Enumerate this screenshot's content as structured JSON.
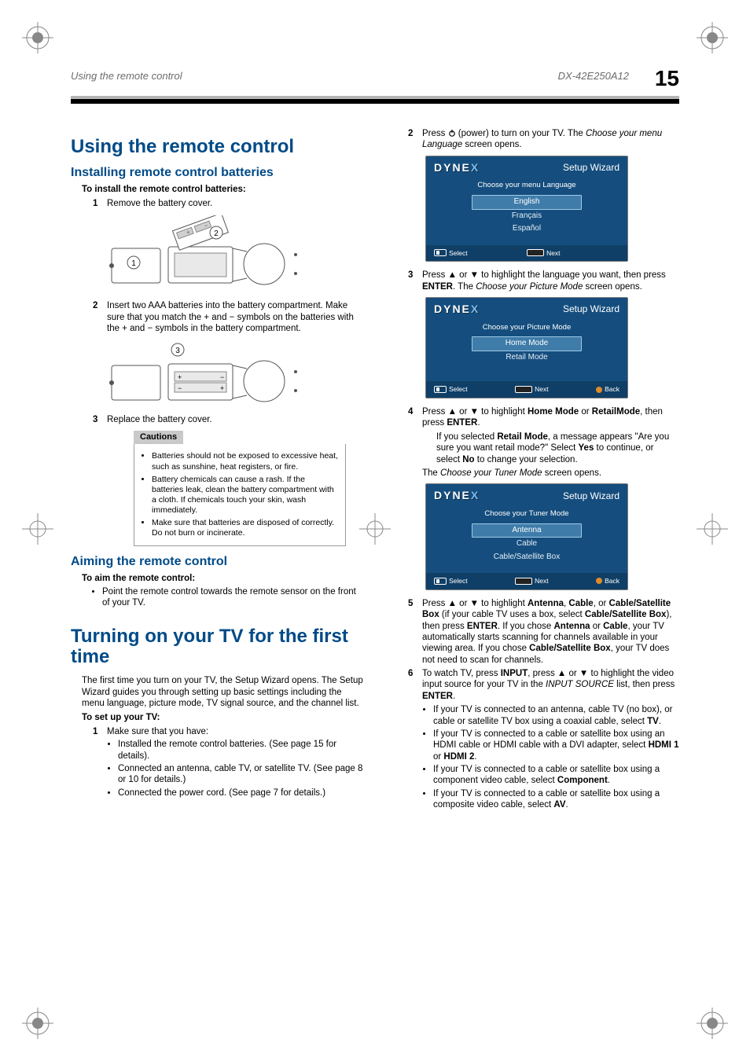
{
  "running_header": {
    "left": "Using the remote control",
    "right_model": "DX-42E250A12",
    "page_number": "15"
  },
  "left_col": {
    "h1_remote": "Using the remote control",
    "h2_install": "Installing remote control batteries",
    "lede_install": "To install the remote control batteries:",
    "step1_install": "Remove the battery cover.",
    "step2_install": "Insert two AAA batteries into the battery compartment. Make sure that you match the + and − symbols on the batteries with the + and − symbols in the battery compartment.",
    "step3_install": "Replace the battery cover.",
    "cautions_hdr": "Cautions",
    "cautions": [
      "Batteries should not be exposed to excessive heat, such as sunshine, heat registers, or fire.",
      "Battery chemicals can cause a rash. If the batteries leak, clean the battery compartment with a cloth. If chemicals touch your skin, wash immediately.",
      "Make sure that batteries are disposed of correctly. Do not burn or incinerate."
    ],
    "h2_aim": "Aiming the remote control",
    "lede_aim": "To aim the remote control:",
    "aim_bullet": "Point the remote control towards the remote sensor on the front of your TV.",
    "h1_turnon": "Turning on your TV for the first time",
    "turnon_intro": "The first time you turn on your TV, the Setup Wizard opens. The Setup Wizard guides you through setting up basic settings including the menu language, picture mode, TV signal source, and the channel list.",
    "lede_setup": "To set up your TV:",
    "setup_step1": "Make sure that you have:",
    "setup_step1_bullets": [
      "Installed the remote control batteries. (See page 15 for details).",
      "Connected an antenna, cable TV, or satellite TV. (See page 8 or 10 for details.)",
      "Connected the power cord. (See page 7 for details.)"
    ],
    "fig_labels": {
      "1": "1",
      "2": "2",
      "3": "3"
    }
  },
  "right_col": {
    "step2": {
      "n": "2",
      "text_a": "Press ",
      "text_b": " (power) to turn on your TV. The ",
      "italic1": "Choose your menu Language",
      "text_c": " screen opens."
    },
    "wiz_title": "Setup Wizard",
    "wiz_brand_a": "DYNE",
    "wiz_brand_x": "X",
    "wiz_lang": {
      "prompt": "Choose your menu Language",
      "opts": [
        "English",
        "Français",
        "Español"
      ],
      "foot_select": "Select",
      "foot_next": "Next"
    },
    "step3": {
      "n": "3",
      "text_a": "Press ▲ or ▼ to highlight the language you want, then press ",
      "bold1": "ENTER",
      "text_b": ". The ",
      "italic1": "Choose your Picture Mode",
      "text_c": " screen opens."
    },
    "wiz_pic": {
      "prompt": "Choose your Picture Mode",
      "opts": [
        "Home Mode",
        "Retail Mode"
      ],
      "foot_select": "Select",
      "foot_next": "Next",
      "foot_back": "Back"
    },
    "step4": {
      "n": "4",
      "line1_a": "Press ▲ or ▼ to highlight ",
      "b1": "Home Mode",
      "line1_b": " or ",
      "b2": "RetailMode",
      "line1_c": ", then press ",
      "b3": "ENTER",
      "line1_d": ".",
      "sub_a": "If you selected ",
      "sub_b1": "Retail Mode",
      "sub_b": ", a message appears \"Are you sure you want retail mode?\" Select ",
      "sub_b2": "Yes",
      "sub_c": " to continue, or select ",
      "sub_b3": "No",
      "sub_d": " to change your selection.",
      "line2_a": "The ",
      "line2_i": "Choose your Tuner Mode",
      "line2_b": " screen opens."
    },
    "wiz_tuner": {
      "prompt": "Choose your  Tuner Mode",
      "opts": [
        "Antenna",
        "Cable",
        "Cable/Satellite Box"
      ],
      "foot_select": "Select",
      "foot_next": "Next",
      "foot_back": "Back"
    },
    "step5": {
      "n": "5",
      "t1": "Press ▲ or ▼ to highlight ",
      "b1": "Antenna",
      "t2": ", ",
      "b2": "Cable",
      "t3": ", or ",
      "b3": "Cable/Satellite Box",
      "t4": " (if your cable TV uses a box, select ",
      "b4": "Cable/Satellite Box",
      "t5": "), then press ",
      "b5": "ENTER",
      "t6": ". If you chose ",
      "b6": "Antenna",
      "t7": " or ",
      "b7": "Cable",
      "t8": ", your TV automatically starts scanning for channels available in your viewing area. If you chose ",
      "b8": "Cable/Satellite Box",
      "t9": ", your TV does not need to scan for channels."
    },
    "step6": {
      "n": "6",
      "t1": "To watch TV, press ",
      "b1": "INPUT",
      "t2": ", press ▲ or ▼ to highlight the video input source for your TV in the ",
      "i1": "INPUT SOURCE",
      "t3": " list, then press ",
      "b2": "ENTER",
      "t4": ".",
      "bullets": [
        {
          "a": "If your TV is connected to an antenna, cable TV (no box), or cable or satellite TV box using a coaxial cable, select ",
          "b": "TV",
          "c": "."
        },
        {
          "a": "If your TV is connected to a cable or satellite box using an HDMI cable or HDMI cable with a DVI adapter, select ",
          "b": "HDMI 1",
          "mid": " or ",
          "b2": "HDMI 2",
          "c": "."
        },
        {
          "a": "If your TV is connected to a cable or satellite box using a component video cable, select ",
          "b": "Component",
          "c": "."
        },
        {
          "a": "If your TV is connected to a cable or satellite box using a composite video cable, select ",
          "b": "AV",
          "c": "."
        }
      ]
    }
  }
}
